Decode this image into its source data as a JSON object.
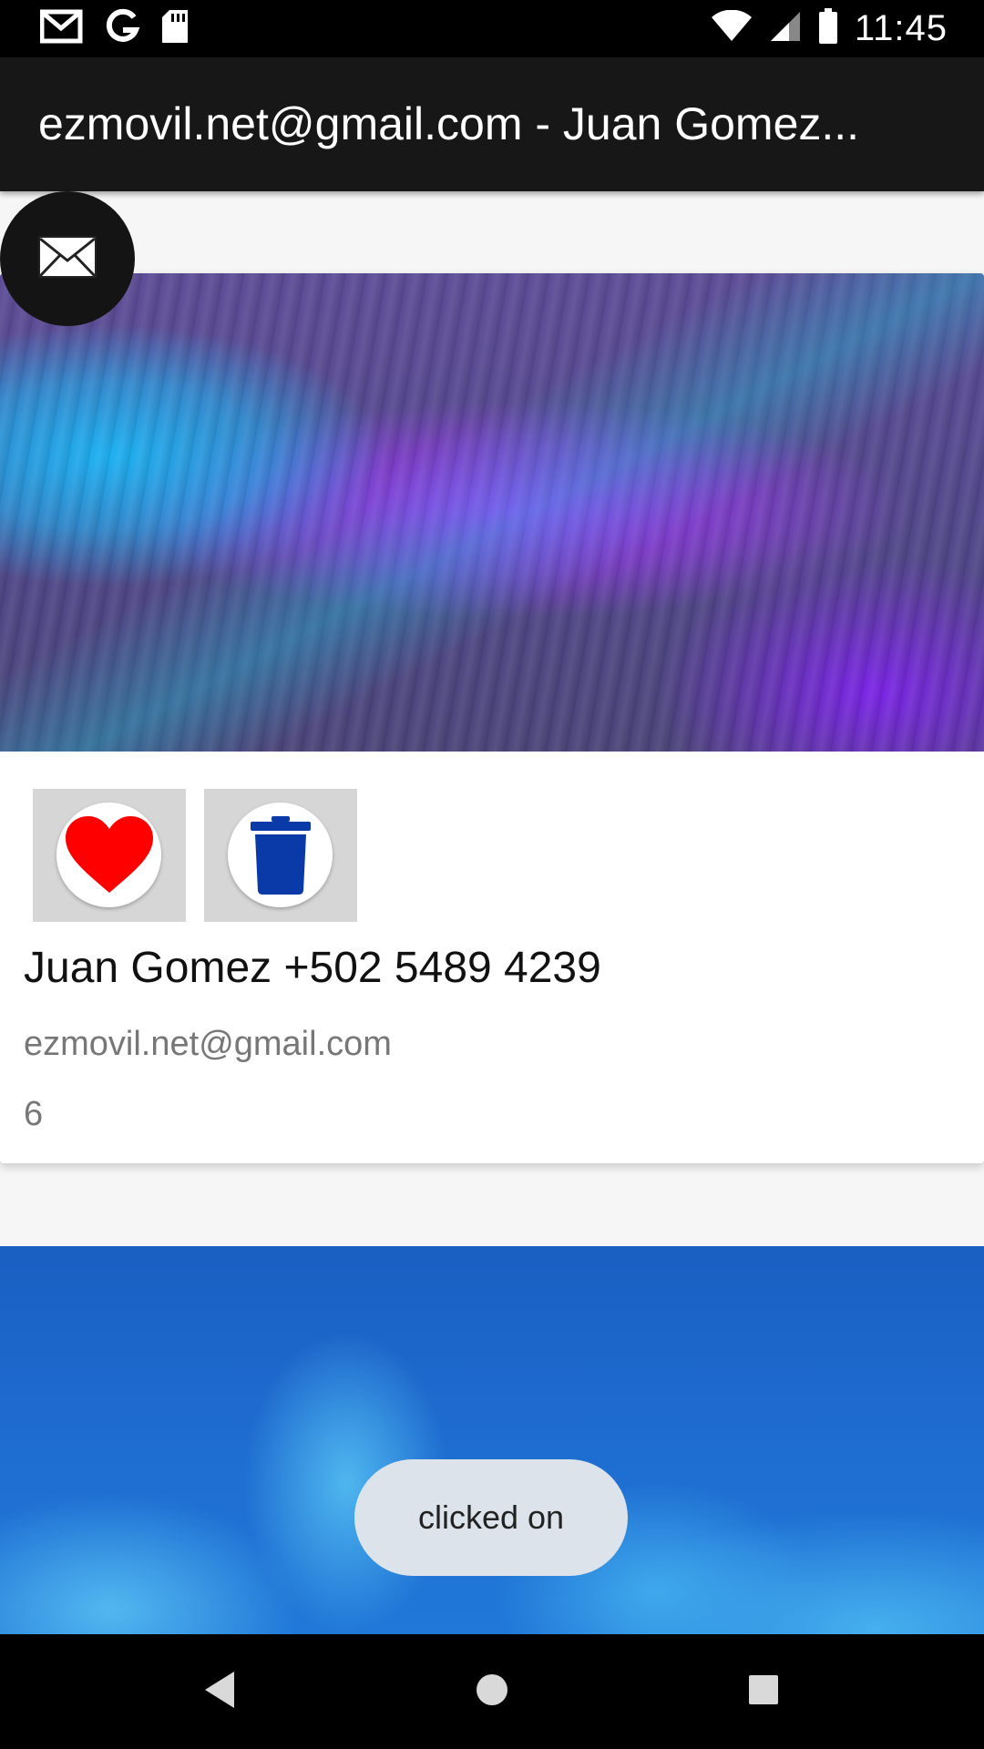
{
  "status_bar": {
    "time": "11:45",
    "left_icons": [
      "gmail-icon",
      "google-icon",
      "sd-card-icon"
    ],
    "right_icons": [
      "wifi-icon",
      "signal-icon",
      "battery-icon"
    ]
  },
  "app_bar": {
    "title": "ezmovil.net@gmail.com - Juan Gomez..."
  },
  "fab": {
    "icon": "envelope-icon"
  },
  "cards": [
    {
      "image": "abstract-purple-blue-wave",
      "actions": [
        {
          "icon": "heart-icon",
          "color": "#ff0000"
        },
        {
          "icon": "trash-icon",
          "color": "#0a3aa8"
        }
      ],
      "name": "Juan Gomez +502 5489 4239",
      "email": "ezmovil.net@gmail.com",
      "count": "6"
    },
    {
      "image": "abstract-blue-waves"
    }
  ],
  "toast": {
    "text": "clicked on"
  },
  "nav_bar": {
    "buttons": [
      "back-icon",
      "home-icon",
      "recents-icon"
    ]
  }
}
